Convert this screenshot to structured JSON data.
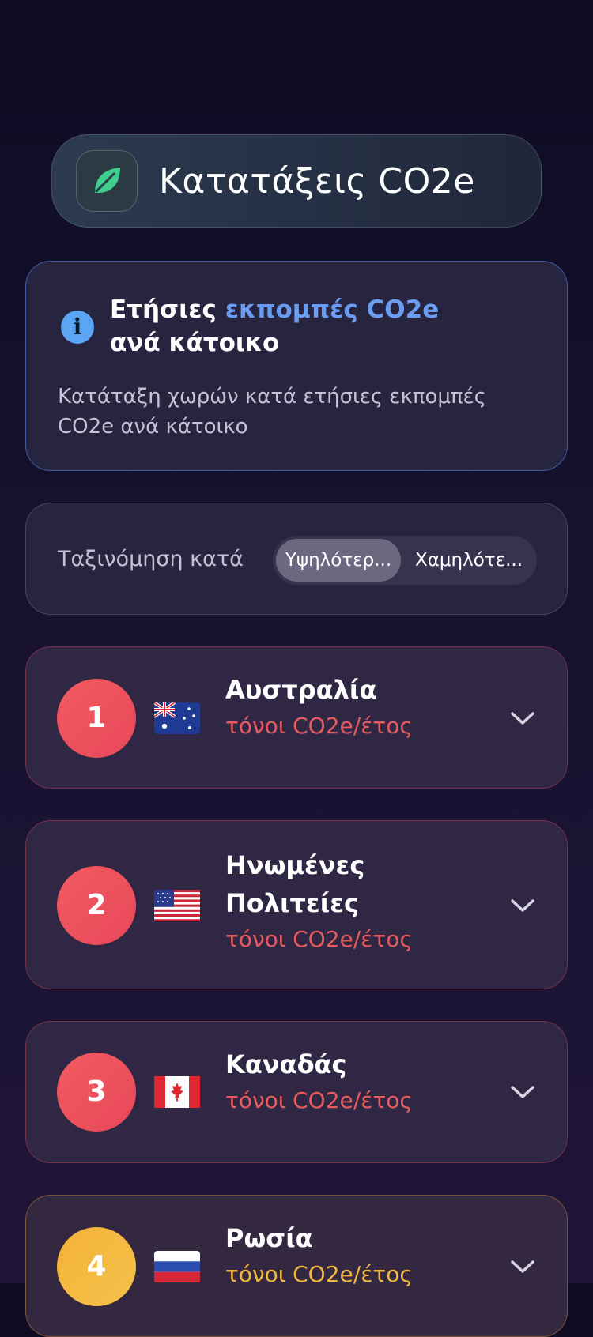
{
  "header": {
    "title": "Κατατάξεις CO2e",
    "logo_icon": "leaf-icon",
    "logo_color": "#3ecf8e"
  },
  "info": {
    "icon": "info-icon",
    "heading_part1": "Ετήσιες ",
    "heading_accent": "εκπομπές CO2e",
    "heading_part2": "ανά κάτοικο",
    "description": "Κατάταξη χωρών κατά ετήσιες εκπομπές CO2e ανά κάτοικο",
    "accent_color": "#6a9cf2"
  },
  "sort": {
    "label": "Ταξινόμηση κατά",
    "options": [
      {
        "label": "Υψηλότερ...",
        "selected": true
      },
      {
        "label": "Χαμηλότε...",
        "selected": false
      }
    ]
  },
  "countries": [
    {
      "rank": "1",
      "name": "Αυστραλία",
      "unit": "τόνοι CO2e/έτος",
      "flag": "australia-flag-icon"
    },
    {
      "rank": "2",
      "name": "Ηνωμένες Πολιτείες",
      "unit": "τόνοι CO2e/έτος",
      "flag": "usa-flag-icon"
    },
    {
      "rank": "3",
      "name": "Καναδάς",
      "unit": "τόνοι CO2e/έτος",
      "flag": "canada-flag-icon"
    },
    {
      "rank": "4",
      "name": "Ρωσία",
      "unit": "τόνοι CO2e/έτος",
      "flag": "russia-flag-icon"
    }
  ],
  "colors": {
    "rank_red": "#ef5160",
    "rank_gold": "#f4b83e",
    "unit_red": "#e85a5e"
  }
}
